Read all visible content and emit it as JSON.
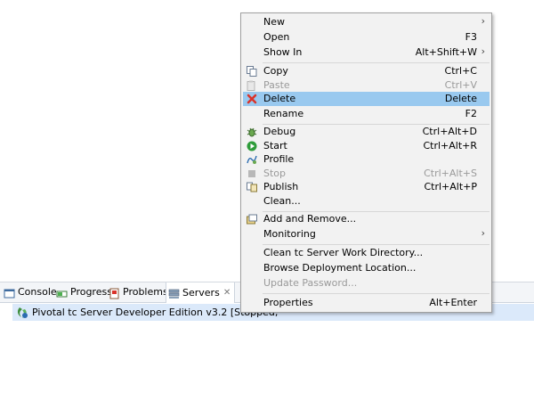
{
  "tabs": [
    {
      "label": "Console",
      "icon": "console-icon"
    },
    {
      "label": "Progress",
      "icon": "progress-icon"
    },
    {
      "label": "Problems",
      "icon": "problems-icon"
    },
    {
      "label": "Servers",
      "icon": "servers-icon",
      "close": "✕"
    }
  ],
  "server": {
    "label": "Pivotal tc Server Developer Edition v3.2  [Stopped,"
  },
  "menu": {
    "new": {
      "label": "New",
      "submenu": "›"
    },
    "open": {
      "label": "Open",
      "accel": "F3"
    },
    "show_in": {
      "label": "Show In",
      "accel": "Alt+Shift+W",
      "submenu": "›"
    },
    "copy": {
      "label": "Copy",
      "accel": "Ctrl+C"
    },
    "paste": {
      "label": "Paste",
      "accel": "Ctrl+V"
    },
    "delete": {
      "label": "Delete",
      "accel": "Delete"
    },
    "rename": {
      "label": "Rename",
      "accel": "F2"
    },
    "debug": {
      "label": "Debug",
      "accel": "Ctrl+Alt+D"
    },
    "start": {
      "label": "Start",
      "accel": "Ctrl+Alt+R"
    },
    "profile": {
      "label": "Profile"
    },
    "stop": {
      "label": "Stop",
      "accel": "Ctrl+Alt+S"
    },
    "publish": {
      "label": "Publish",
      "accel": "Ctrl+Alt+P"
    },
    "clean": {
      "label": "Clean..."
    },
    "add_remove": {
      "label": "Add and Remove..."
    },
    "monitoring": {
      "label": "Monitoring",
      "submenu": "›"
    },
    "clean_workdir": {
      "label": "Clean tc Server Work Directory..."
    },
    "browse_deploy": {
      "label": "Browse Deployment Location..."
    },
    "update_password": {
      "label": "Update Password..."
    },
    "properties": {
      "label": "Properties",
      "accel": "Alt+Enter"
    }
  },
  "colors": {
    "highlight": "#99c9ef",
    "menu_bg": "#f2f2f2",
    "row_selected": "#dbe9fa"
  }
}
